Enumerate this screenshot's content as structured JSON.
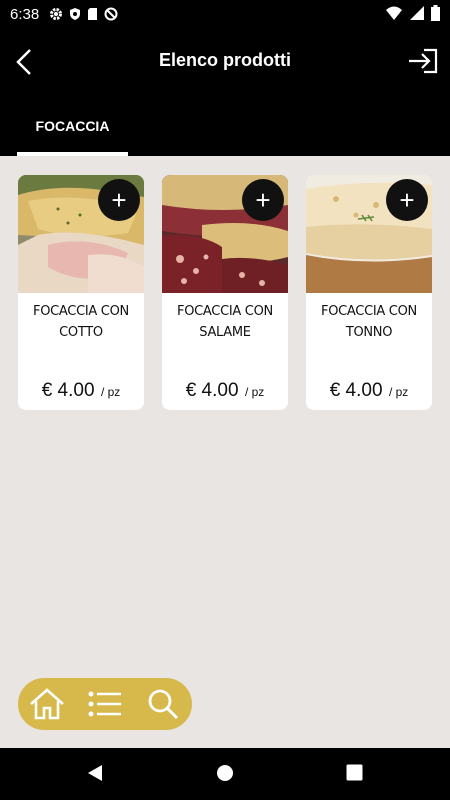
{
  "status": {
    "time": "6:38"
  },
  "header": {
    "title": "Elenco prodotti"
  },
  "tabs": [
    {
      "label": "FOCACCIA"
    }
  ],
  "products": [
    {
      "name": "FOCACCIA CON COTTO",
      "price": "€ 4.00",
      "unit": "/ pz"
    },
    {
      "name": "FOCACCIA CON SALAME",
      "price": "€ 4.00",
      "unit": "/ pz"
    },
    {
      "name": "FOCACCIA CON TONNO",
      "price": "€ 4.00",
      "unit": "/ pz"
    }
  ],
  "add_symbol": "+",
  "bottom_nav": {
    "icons": [
      "home-icon",
      "list-icon",
      "search-icon"
    ]
  },
  "colors": {
    "accent": "#d6b84b",
    "background": "#e8e5e2",
    "bar": "#000000"
  }
}
